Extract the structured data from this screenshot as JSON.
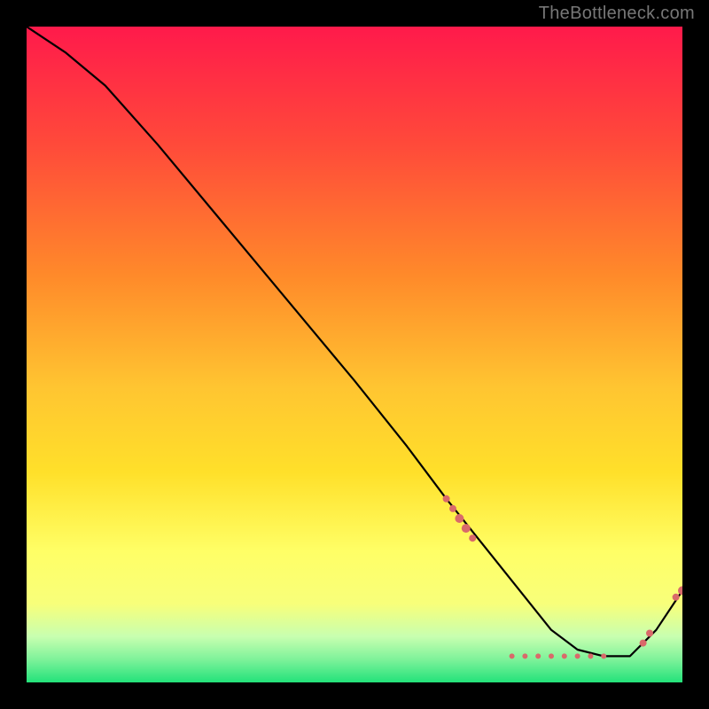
{
  "watermark": "TheBottleneck.com",
  "colors": {
    "gradient_top": "#ff1a4b",
    "gradient_upper_mid": "#ff8a2a",
    "gradient_mid": "#ffe02a",
    "gradient_lower_mid": "#f8ff7a",
    "gradient_low": "#c8ffb0",
    "gradient_bottom": "#23e27a",
    "marker": "#d96a6a",
    "line": "#000000",
    "frame": "#000000"
  },
  "chart_data": {
    "type": "line",
    "title": "",
    "xlabel": "",
    "ylabel": "",
    "xlim": [
      0,
      100
    ],
    "ylim": [
      0,
      100
    ],
    "series": [
      {
        "name": "curve",
        "x": [
          0,
          6,
          12,
          20,
          30,
          40,
          50,
          58,
          64,
          68,
          72,
          76,
          80,
          84,
          88,
          90,
          92,
          96,
          100
        ],
        "y": [
          100,
          96,
          91,
          82,
          70,
          58,
          46,
          36,
          28,
          23,
          18,
          13,
          8,
          5,
          4,
          4,
          4,
          8,
          14
        ]
      }
    ],
    "markers": [
      {
        "x": 64,
        "y": 28,
        "r": 4
      },
      {
        "x": 65,
        "y": 26.5,
        "r": 4
      },
      {
        "x": 66,
        "y": 25,
        "r": 5
      },
      {
        "x": 67,
        "y": 23.5,
        "r": 5
      },
      {
        "x": 68,
        "y": 22,
        "r": 4
      },
      {
        "x": 74,
        "y": 4,
        "r": 3
      },
      {
        "x": 76,
        "y": 4,
        "r": 3
      },
      {
        "x": 78,
        "y": 4,
        "r": 3
      },
      {
        "x": 80,
        "y": 4,
        "r": 3
      },
      {
        "x": 82,
        "y": 4,
        "r": 3
      },
      {
        "x": 84,
        "y": 4,
        "r": 3
      },
      {
        "x": 86,
        "y": 4,
        "r": 3
      },
      {
        "x": 88,
        "y": 4,
        "r": 3
      },
      {
        "x": 94,
        "y": 6,
        "r": 4
      },
      {
        "x": 95,
        "y": 7.5,
        "r": 4
      },
      {
        "x": 99,
        "y": 13,
        "r": 4
      },
      {
        "x": 100,
        "y": 14,
        "r": 5
      }
    ]
  }
}
